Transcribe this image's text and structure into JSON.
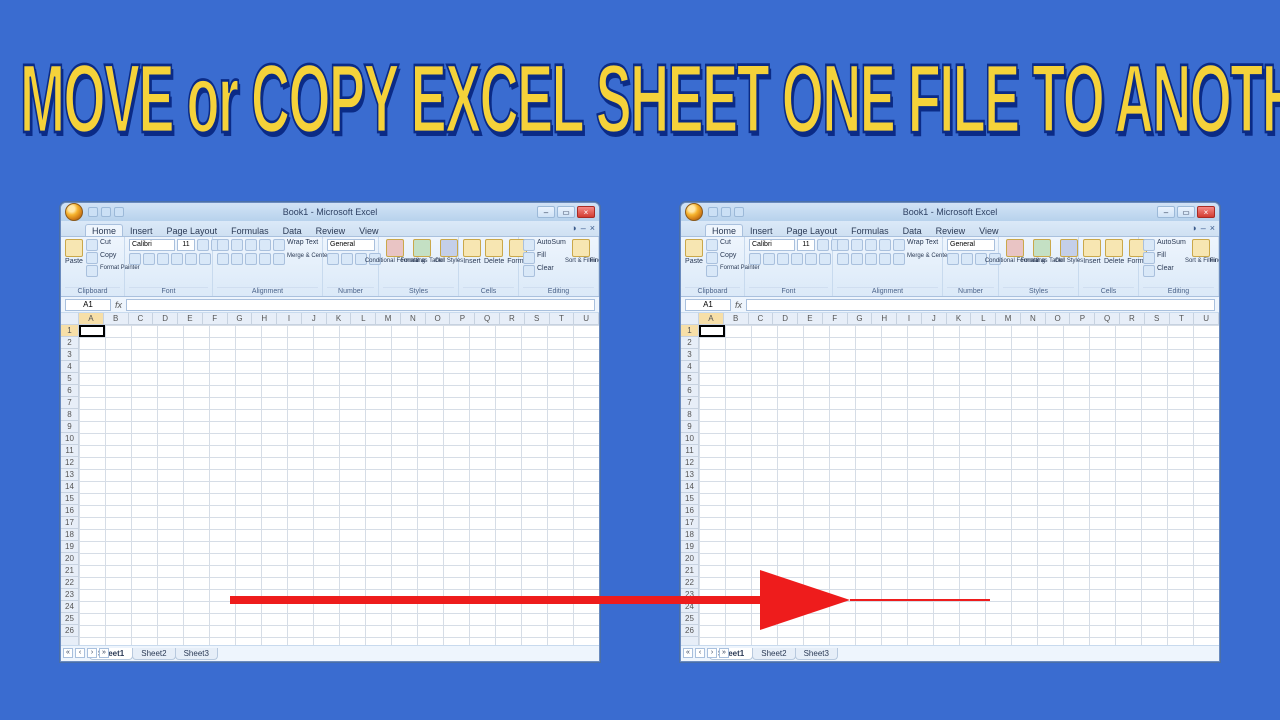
{
  "headline": "MOVE or COPY EXCEL SHEET ONE FILE TO ANOTHER",
  "excel": {
    "title": "Book1 - Microsoft Excel",
    "tabs": [
      "Home",
      "Insert",
      "Page Layout",
      "Formulas",
      "Data",
      "Review",
      "View"
    ],
    "active_tab": "Home",
    "clipboard": {
      "paste": "Paste",
      "cut": "Cut",
      "copy": "Copy",
      "painter": "Format Painter",
      "label": "Clipboard"
    },
    "font": {
      "name": "Calibri",
      "size": "11",
      "label": "Font"
    },
    "alignment": {
      "wrap": "Wrap Text",
      "merge": "Merge & Center",
      "label": "Alignment"
    },
    "number": {
      "format": "General",
      "label": "Number"
    },
    "styles": {
      "cond": "Conditional Formatting",
      "fmt": "Format as Table",
      "cell": "Cell Styles",
      "label": "Styles"
    },
    "cells_grp": {
      "insert": "Insert",
      "delete": "Delete",
      "format": "Format",
      "label": "Cells"
    },
    "editing": {
      "autosum": "AutoSum",
      "fill": "Fill",
      "clear": "Clear",
      "sort": "Sort & Filter",
      "find": "Find & Select",
      "label": "Editing"
    },
    "namebox": "A1",
    "fx": "fx",
    "columns": [
      "A",
      "B",
      "C",
      "D",
      "E",
      "F",
      "G",
      "H",
      "I",
      "J",
      "K",
      "L",
      "M",
      "N",
      "O",
      "P",
      "Q",
      "R",
      "S",
      "T",
      "U"
    ],
    "rows": [
      "1",
      "2",
      "3",
      "4",
      "5",
      "6",
      "7",
      "8",
      "9",
      "10",
      "11",
      "12",
      "13",
      "14",
      "15",
      "16",
      "17",
      "18",
      "19",
      "20",
      "21",
      "22",
      "23",
      "24",
      "25",
      "26"
    ],
    "sheets": [
      "Sheet1",
      "Sheet2",
      "Sheet3"
    ],
    "active_sheet": "Sheet1"
  }
}
